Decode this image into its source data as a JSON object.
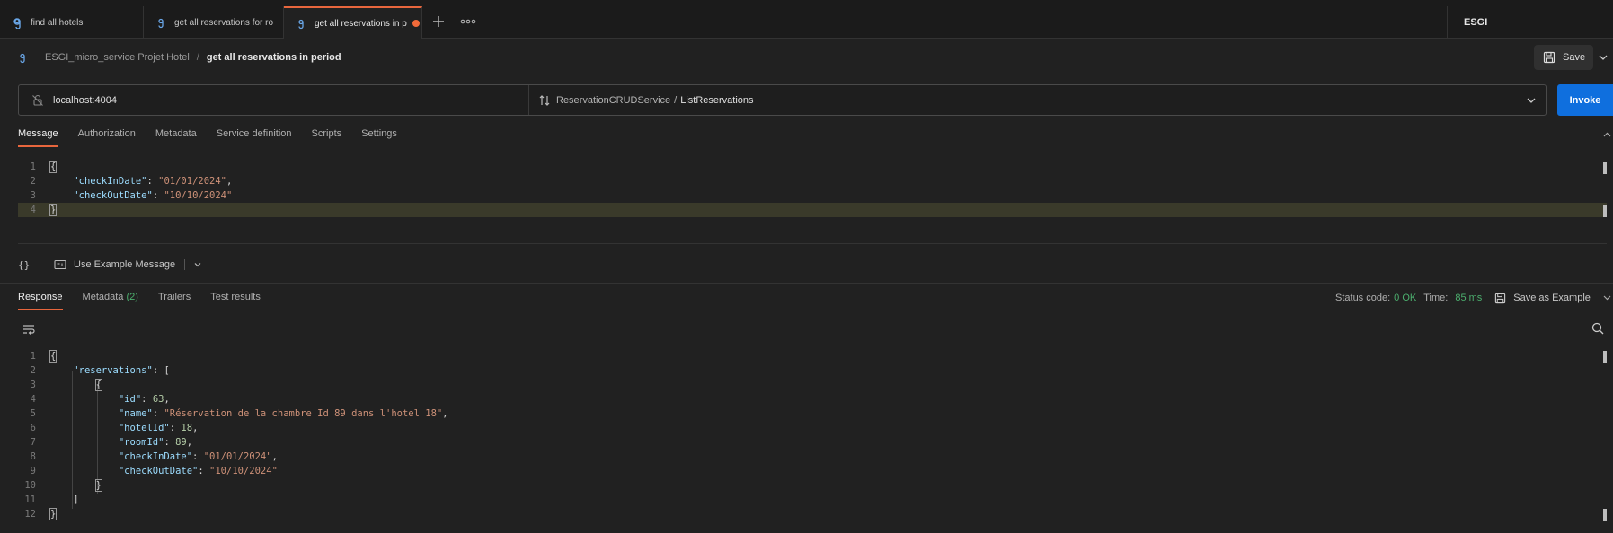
{
  "tabs": [
    {
      "label": "find all hotels",
      "icon": "grpc-icon",
      "active": false
    },
    {
      "label": "get all reservations for ro",
      "icon": "grpc-icon",
      "active": false
    },
    {
      "label": "get all reservations in p",
      "icon": "grpc-icon",
      "active": true,
      "unsaved": true
    }
  ],
  "workspace": "ESGI",
  "breadcrumb": {
    "collection": "ESGI_micro_service Projet Hotel",
    "separator": "/",
    "current": "get all reservations in period"
  },
  "save_label": "Save",
  "url": {
    "host": "localhost:4004",
    "service": "ReservationCRUDService",
    "separator": "/",
    "method": "ListReservations"
  },
  "invoke_label": "Invoke",
  "request_tabs": [
    "Message",
    "Authorization",
    "Metadata",
    "Service definition",
    "Scripts",
    "Settings"
  ],
  "request_message": {
    "line_numbers": [
      "1",
      "2",
      "3",
      "4"
    ],
    "checkInDate_key": "\"checkInDate\"",
    "checkInDate_value": "\"01/01/2024\"",
    "checkOutDate_key": "\"checkOutDate\"",
    "checkOutDate_value": "\"10/10/2024\""
  },
  "message_toolbar": {
    "braces": "{}",
    "use_example": "Use Example Message"
  },
  "response_tabs": {
    "response": "Response",
    "metadata": "Metadata",
    "metadata_count": "(2)",
    "trailers": "Trailers",
    "test_results": "Test results"
  },
  "status": {
    "code_label": "Status code:",
    "code_value": "0 OK",
    "time_label": "Time:",
    "time_value": "85 ms",
    "save_example": "Save as Example"
  },
  "response": {
    "line_numbers": [
      "1",
      "2",
      "3",
      "4",
      "5",
      "6",
      "7",
      "8",
      "9",
      "10",
      "11",
      "12"
    ],
    "reservations_key": "\"reservations\"",
    "id_key": "\"id\"",
    "id_value": "63",
    "name_key": "\"name\"",
    "name_value": "\"Réservation de la chambre Id 89 dans l'hotel 18\"",
    "hotelId_key": "\"hotelId\"",
    "hotelId_value": "18",
    "roomId_key": "\"roomId\"",
    "roomId_value": "89",
    "checkInDate_key": "\"checkInDate\"",
    "checkInDate_value": "\"01/01/2024\"",
    "checkOutDate_key": "\"checkOutDate\"",
    "checkOutDate_value": "\"10/10/2024\""
  },
  "colors": {
    "accent": "#e8663d",
    "invoke": "#0f6fde",
    "status_ok": "#4caf6e",
    "json_key": "#9cdcfe",
    "json_string": "#ce9178"
  }
}
